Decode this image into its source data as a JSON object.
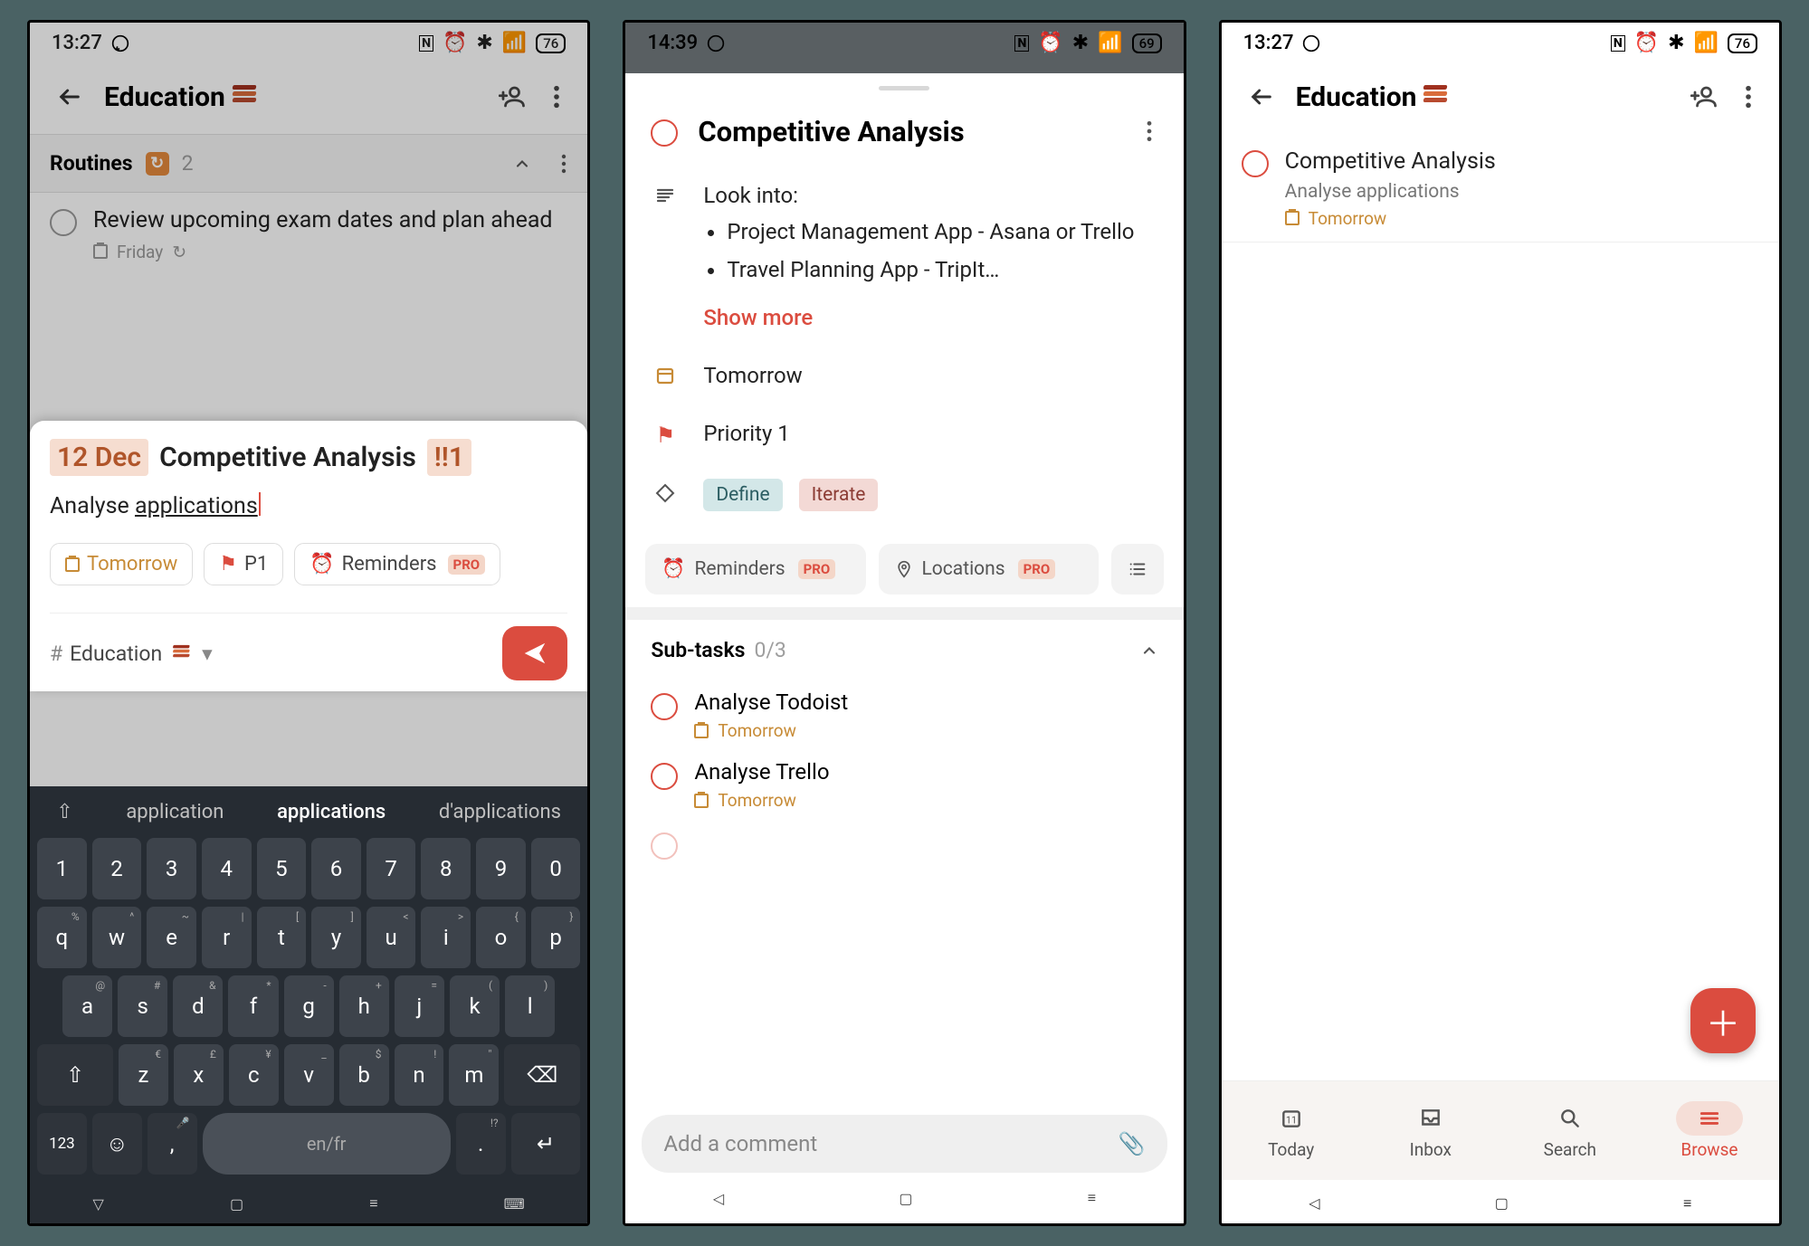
{
  "phones": {
    "p1": {
      "status": {
        "time": "13:27",
        "battery": "76"
      },
      "appbar": {
        "title": "Education"
      },
      "section": {
        "name": "Routines",
        "count": "2"
      },
      "task": {
        "title": "Review upcoming exam dates and plan ahead",
        "meta": "Friday"
      },
      "compose": {
        "date_chip": "12 Dec",
        "title": "Competitive Analysis",
        "priority_chip": "!!1",
        "description_before": "Analyse ",
        "description_underline": "applications",
        "chips": {
          "tomorrow": "Tomorrow",
          "p1": "P1",
          "reminders": "Reminders",
          "pro": "PRO"
        },
        "project": "Education"
      },
      "keyboard": {
        "suggestions": [
          "application",
          "applications",
          "d'applications"
        ],
        "row_num": [
          "1",
          "2",
          "3",
          "4",
          "5",
          "6",
          "7",
          "8",
          "9",
          "0"
        ],
        "row_q": [
          {
            "k": "q",
            "s": "%"
          },
          {
            "k": "w",
            "s": "^"
          },
          {
            "k": "e",
            "s": "~"
          },
          {
            "k": "r",
            "s": "|"
          },
          {
            "k": "t",
            "s": "["
          },
          {
            "k": "y",
            "s": "]"
          },
          {
            "k": "u",
            "s": "<"
          },
          {
            "k": "i",
            "s": ">"
          },
          {
            "k": "o",
            "s": "{"
          },
          {
            "k": "p",
            "s": "}"
          }
        ],
        "row_a": [
          {
            "k": "a",
            "s": "@"
          },
          {
            "k": "s",
            "s": "#"
          },
          {
            "k": "d",
            "s": "&"
          },
          {
            "k": "f",
            "s": "*"
          },
          {
            "k": "g",
            "s": "-"
          },
          {
            "k": "h",
            "s": "+"
          },
          {
            "k": "j",
            "s": "="
          },
          {
            "k": "k",
            "s": "("
          },
          {
            "k": "l",
            "s": ")"
          }
        ],
        "row_z": [
          {
            "k": "z",
            "s": "€"
          },
          {
            "k": "x",
            "s": "£"
          },
          {
            "k": "c",
            "s": "¥"
          },
          {
            "k": "v",
            "s": "_"
          },
          {
            "k": "b",
            "s": "$"
          },
          {
            "k": "n",
            "s": "!"
          },
          {
            "k": "m",
            "s": "\""
          }
        ],
        "bottom": {
          "num": "123",
          "lang": "en/fr"
        }
      }
    },
    "p2": {
      "status": {
        "time": "14:39",
        "battery": "69"
      },
      "title": "Competitive Analysis",
      "notes_intro": "Look into:",
      "notes_items": [
        "Project Management App - Asana or Trello",
        "Travel Planning App - TripIt…"
      ],
      "show_more": "Show more",
      "due": "Tomorrow",
      "priority": "Priority 1",
      "tags": {
        "a": "Define",
        "b": "Iterate"
      },
      "actions": {
        "reminders": "Reminders",
        "locations": "Locations",
        "pro": "PRO"
      },
      "subtasks": {
        "header": "Sub-tasks",
        "count": "0/3",
        "items": [
          {
            "title": "Analyse Todoist",
            "meta": "Tomorrow"
          },
          {
            "title": "Analyse Trello",
            "meta": "Tomorrow"
          }
        ]
      },
      "comment_placeholder": "Add a comment"
    },
    "p3": {
      "status": {
        "time": "13:27",
        "battery": "76"
      },
      "appbar": {
        "title": "Education"
      },
      "task": {
        "title": "Competitive Analysis",
        "subtitle": "Analyse applications",
        "meta": "Tomorrow"
      },
      "nav": {
        "today": "Today",
        "inbox": "Inbox",
        "search": "Search",
        "browse": "Browse"
      }
    }
  }
}
